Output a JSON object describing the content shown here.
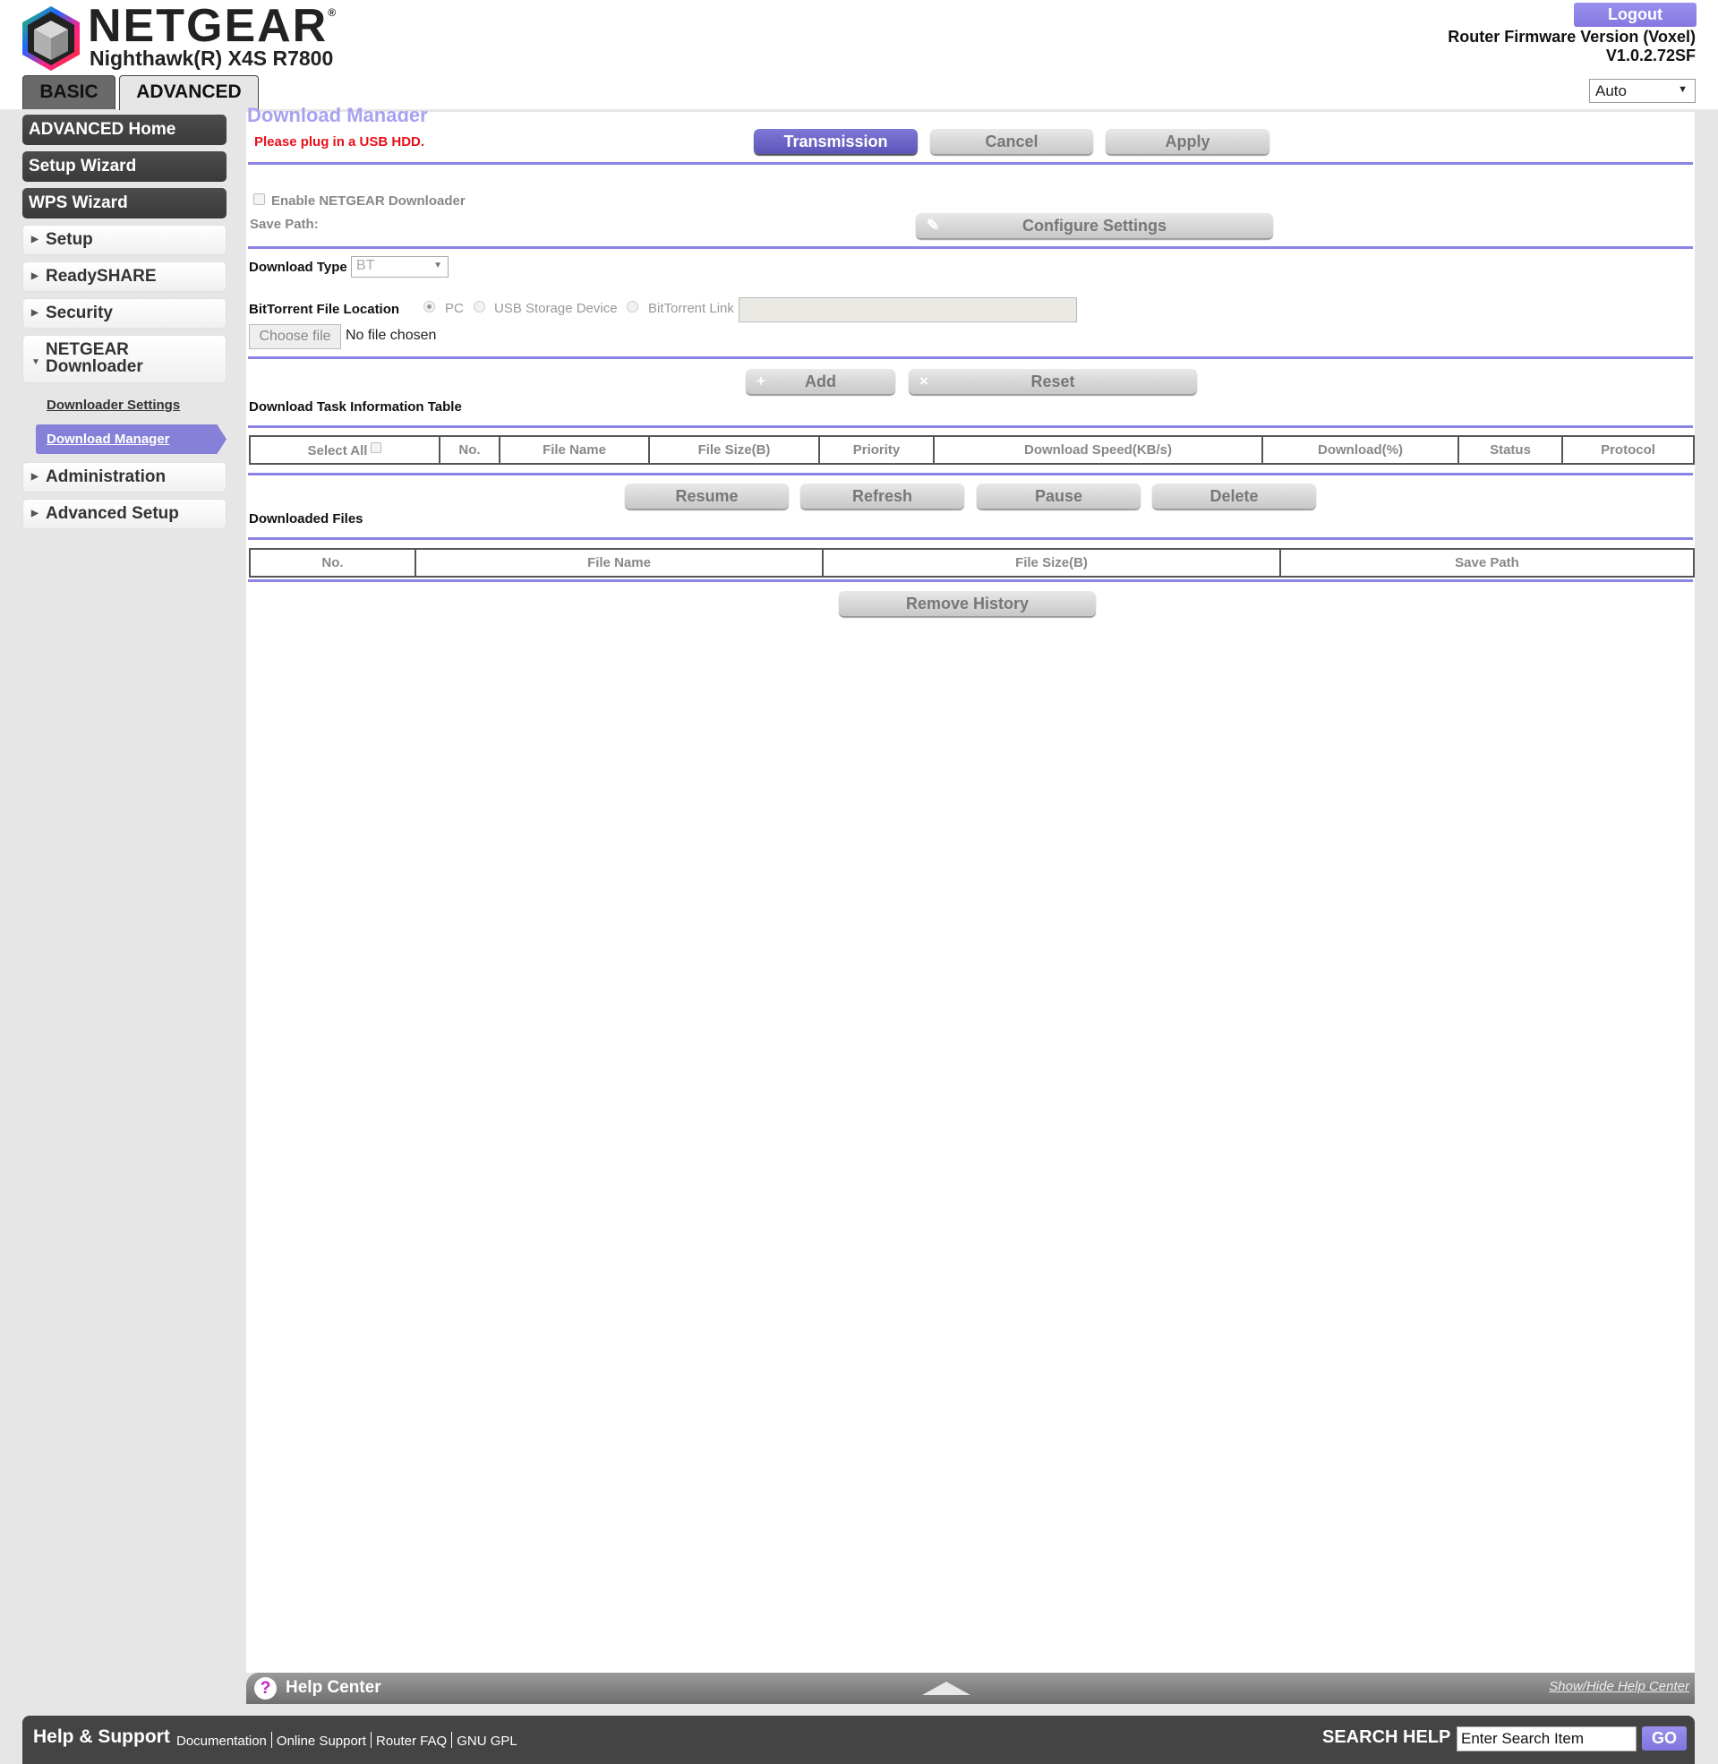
{
  "header": {
    "brand": "NETGEAR",
    "brand_mark": "®",
    "model": "Nighthawk(R) X4S R7800",
    "tabs": [
      {
        "label": "BASIC",
        "active": false
      },
      {
        "label": "ADVANCED",
        "active": true
      }
    ],
    "logout_label": "Logout",
    "firmware_label": "Router Firmware Version (Voxel)",
    "firmware_version": "V1.0.2.72SF",
    "language_select": {
      "selected": "Auto"
    }
  },
  "sidebar": {
    "dark_items": [
      {
        "label": "ADVANCED Home"
      },
      {
        "label": "Setup Wizard"
      },
      {
        "label": "WPS Wizard"
      }
    ],
    "sections": [
      {
        "label": "Setup",
        "expanded": false
      },
      {
        "label": "ReadySHARE",
        "expanded": false
      },
      {
        "label": "Security",
        "expanded": false
      },
      {
        "label_line1": "NETGEAR",
        "label_line2": "Downloader",
        "expanded": true
      },
      {
        "label": "Administration",
        "expanded": false
      },
      {
        "label": "Advanced Setup",
        "expanded": false
      }
    ],
    "sub_items": [
      {
        "label": "Downloader Settings",
        "active": false
      },
      {
        "label": "Download Manager",
        "active": true
      }
    ]
  },
  "main": {
    "title": "Download Manager",
    "warning": "Please plug in a USB HDD.",
    "buttons": {
      "transmission": "Transmission",
      "cancel": "Cancel",
      "apply": "Apply",
      "configure": "Configure Settings",
      "add": "Add",
      "reset": "Reset",
      "resume": "Resume",
      "refresh": "Refresh",
      "pause": "Pause",
      "delete": "Delete",
      "remove_history": "Remove History"
    },
    "enable_downloader": {
      "label": "Enable NETGEAR Downloader",
      "checked": false
    },
    "save_path_label": "Save Path:",
    "download_type": {
      "label": "Download Type",
      "selected": "BT"
    },
    "bt_location": {
      "label": "BitTorrent File Location",
      "options": [
        {
          "label": "PC",
          "selected": true
        },
        {
          "label": "USB Storage Device",
          "selected": false
        },
        {
          "label": "BitTorrent Link",
          "selected": false
        }
      ],
      "link_value": ""
    },
    "file_picker": {
      "button": "Choose file",
      "status": "No file chosen"
    },
    "task_table": {
      "title": "Download Task Information Table",
      "select_all_label": "Select All",
      "columns": [
        "No.",
        "File Name",
        "File Size(B)",
        "Priority",
        "Download Speed(KB/s)",
        "Download(%)",
        "Status",
        "Protocol"
      ],
      "rows": []
    },
    "downloaded_table": {
      "title": "Downloaded Files",
      "columns": [
        "No.",
        "File Name",
        "File Size(B)",
        "Save Path"
      ],
      "rows": []
    }
  },
  "help_center": {
    "title": "Help Center",
    "toggle_label": "Show/Hide Help Center"
  },
  "footer": {
    "title": "Help & Support",
    "links": [
      "Documentation",
      "Online Support",
      "Router FAQ",
      "GNU GPL"
    ],
    "search_label": "SEARCH HELP",
    "search_placeholder": "Enter Search Item",
    "go_label": "GO"
  },
  "colors": {
    "accent": "#8680d8",
    "warning": "#e8101a",
    "divider": "#8a84e6",
    "dark_nav": "#444444"
  }
}
